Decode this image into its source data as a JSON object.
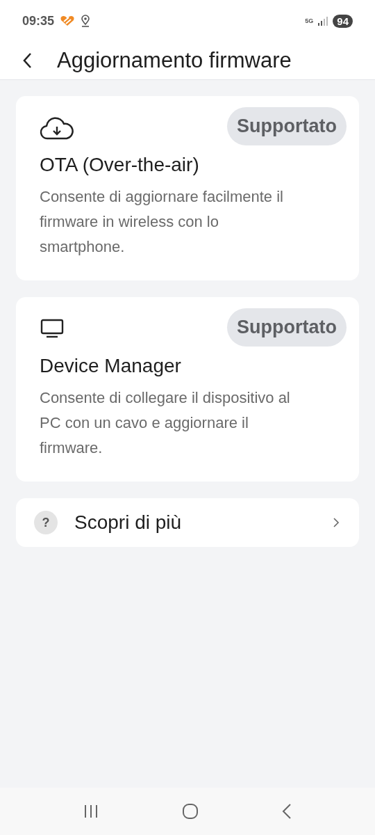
{
  "status_bar": {
    "time": "09:35",
    "network": "5G",
    "battery": "94"
  },
  "header": {
    "title": "Aggiornamento firmware"
  },
  "methods": [
    {
      "kind": "cloud",
      "badge": "Supportato",
      "title": "OTA (Over-the-air)",
      "description": "Consente di aggiornare facilmente il firmware in wireless con lo smartphone."
    },
    {
      "kind": "monitor",
      "badge": "Supportato",
      "title": "Device Manager",
      "description": "Consente di collegare il dispositivo al PC con un cavo e aggiornare il firmware."
    }
  ],
  "learn_more": {
    "icon_glyph": "?",
    "label": "Scopri di più"
  }
}
